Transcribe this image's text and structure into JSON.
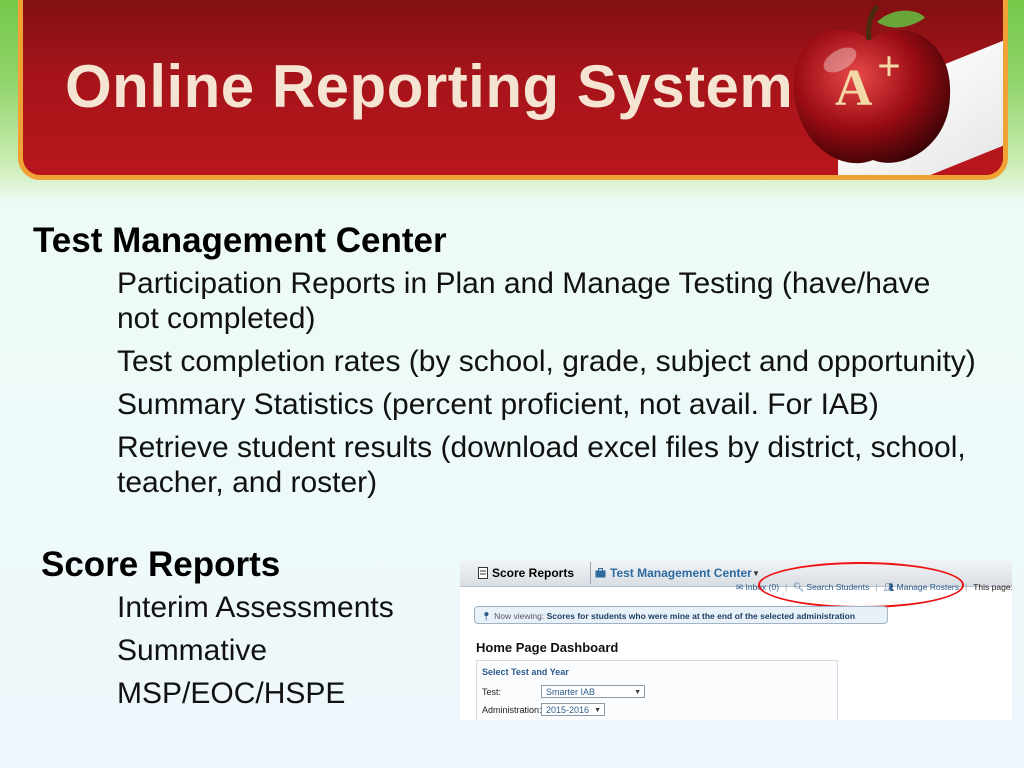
{
  "slide": {
    "title": "Online Reporting System"
  },
  "sections": [
    {
      "heading": "Test Management Center",
      "items": [
        "Participation Reports in Plan and Manage Testing (have/have not completed)",
        "Test completion rates (by school, grade, subject and opportunity)",
        "Summary Statistics (percent proficient, not avail. For IAB)",
        "Retrieve student results (download excel files by district, school, teacher, and roster)"
      ]
    },
    {
      "heading": "Score Reports",
      "items": [
        "Interim Assessments",
        "Summative",
        "MSP/EOC/HSPE"
      ]
    }
  ],
  "screenshot": {
    "tabs": {
      "score_reports": "Score Reports",
      "test_management_center": "Test Management Center"
    },
    "utility": {
      "inbox": "Inbox (0)",
      "search_students": "Search Students",
      "manage_rosters": "Manage Rosters",
      "this_page": "This page:"
    },
    "viewing": {
      "label": "Now viewing:",
      "text": "Scores for students who were mine at the end of the selected administration"
    },
    "dashboard_title": "Home Page Dashboard",
    "form": {
      "heading": "Select Test and Year",
      "test_label": "Test:",
      "test_value": "Smarter IAB",
      "admin_label": "Administration:",
      "admin_value": "2015-2016"
    },
    "highlight_color": "#e11111"
  },
  "colors": {
    "banner": "#a5141a",
    "banner_border": "#f0a334",
    "title_text": "#f6e4d2",
    "link_blue": "#2c6aa0"
  },
  "icons": [
    "apple-a-plus-icon",
    "document-icon",
    "briefcase-icon",
    "map-pin-icon",
    "search-icon",
    "people-icon",
    "inbox-icon"
  ]
}
